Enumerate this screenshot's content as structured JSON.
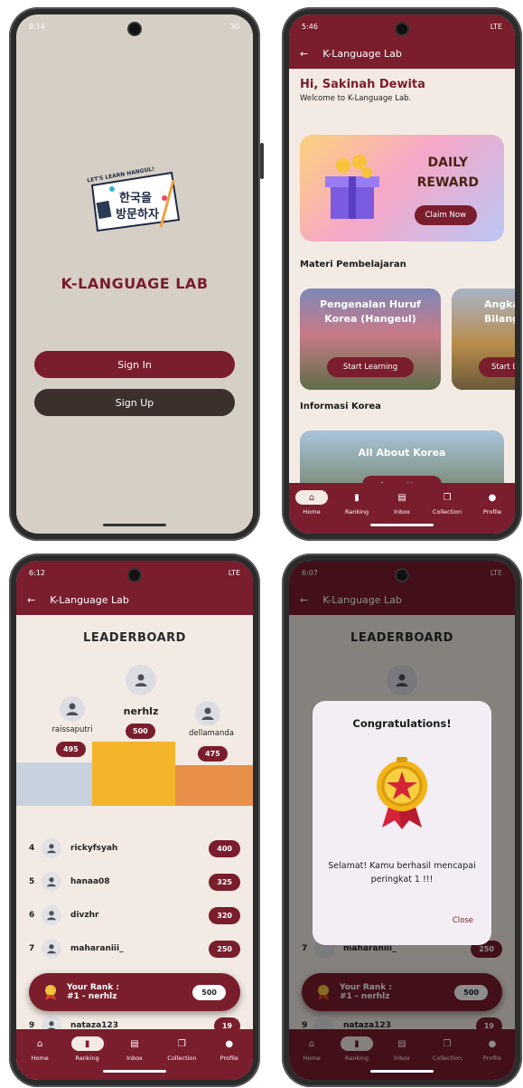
{
  "screen1": {
    "status_time": "8:14",
    "status_right": "3G",
    "logo_text_top": "LET'S LEARN HANGUL!",
    "logo_text_main": "한국을 방문하자",
    "brand": "K-LANGUAGE LAB",
    "sign_in": "Sign In",
    "sign_up": "Sign Up"
  },
  "screen2": {
    "status_time": "5:46",
    "status_right": "LTE",
    "app_title": "K-Language Lab",
    "greeting": "Hi, Sakinah Dewita",
    "welcome": "Welcome to K-Language Lab.",
    "reward_title_1": "DAILY",
    "reward_title_2": "REWARD",
    "claim": "Claim Now",
    "section_materi": "Materi Pembelajaran",
    "courses": [
      {
        "title": "Pengenalan Huruf Korea (Hangeul)",
        "button": "Start Learning"
      },
      {
        "title": "Angka Bilangan",
        "button": "Start Learning"
      }
    ],
    "section_info": "Informasi Korea",
    "info_title": "All About Korea",
    "info_button": "Access Here"
  },
  "nav": [
    {
      "label": "Home",
      "icon": "home-icon",
      "glyph": "⌂"
    },
    {
      "label": "Ranking",
      "icon": "ranking-icon",
      "glyph": "▮"
    },
    {
      "label": "Inbox",
      "icon": "inbox-icon",
      "glyph": "▤"
    },
    {
      "label": "Collection",
      "icon": "collection-icon",
      "glyph": "❐"
    },
    {
      "label": "Profile",
      "icon": "profile-icon",
      "glyph": "●"
    }
  ],
  "screen3": {
    "status_time": "6:12",
    "status_right": "LTE",
    "app_title": "K-Language Lab",
    "title": "LEADERBOARD",
    "podium": {
      "first": {
        "name": "nerhlz",
        "score": "500"
      },
      "second": {
        "name": "raissaputri",
        "score": "495"
      },
      "third": {
        "name": "dellamanda",
        "score": "475"
      }
    },
    "rows": [
      {
        "rank": "4",
        "name": "rickyfsyah",
        "score": "400"
      },
      {
        "rank": "5",
        "name": "hanaa08",
        "score": "325"
      },
      {
        "rank": "6",
        "name": "divzhr",
        "score": "320"
      },
      {
        "rank": "7",
        "name": "maharaniii_",
        "score": "250"
      },
      {
        "rank": "9",
        "name": "nataza123",
        "score": "19"
      }
    ],
    "your_rank_label": "Your Rank :",
    "your_rank_value": "#1 - nerhlz",
    "your_rank_score": "500"
  },
  "screen4": {
    "status_time": "6:07",
    "dialog_title": "Congratulations!",
    "dialog_message": "Selamat! Kamu berhasil mencapai peringkat 1 !!!",
    "close": "Close"
  },
  "colors": {
    "primary": "#7a1d2c",
    "background": "#f3ebe3",
    "splash": "#d6cfc6"
  }
}
